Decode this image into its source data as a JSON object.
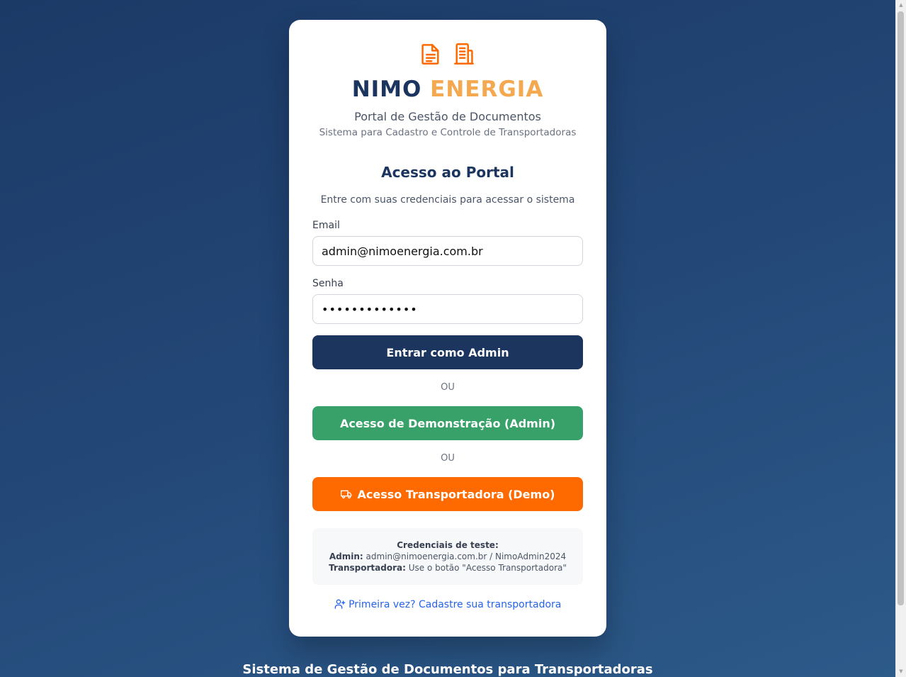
{
  "brand": {
    "name_part1": "NIMO",
    "name_part2": "ENERGIA",
    "subtitle": "Portal de Gestão de Documentos",
    "tagline": "Sistema para Cadastro e Controle de Transportadoras",
    "icons": [
      "document-icon",
      "building-icon"
    ]
  },
  "login": {
    "heading": "Acesso ao Portal",
    "lead": "Entre com suas credenciais para acessar o sistema",
    "email_label": "Email",
    "email_value": "admin@nimoenergia.com.br",
    "password_label": "Senha",
    "password_value": "NimoAdmin2024",
    "submit_label": "Entrar como Admin",
    "or_label_1": "OU",
    "demo_label": "Acesso de Demonstração (Admin)",
    "or_label_2": "OU",
    "carrier_label": "Acesso Transportadora (Demo)",
    "carrier_icon": "truck-icon"
  },
  "credentials": {
    "title": "Credenciais de teste:",
    "admin_key": "Admin:",
    "admin_value": "admin@nimoenergia.com.br / NimoAdmin2024",
    "carrier_key": "Transportadora:",
    "carrier_value": "Use o botão \"Acesso Transportadora\""
  },
  "register": {
    "icon": "user-plus-icon",
    "label": "Primeira vez? Cadastre sua transportadora"
  },
  "footer": {
    "text": "Sistema de Gestão de Documentos para Transportadoras"
  },
  "colors": {
    "navy": "#1b355e",
    "orange_brand": "#f4a850",
    "green": "#38a169",
    "orange_button": "#ff6a00",
    "link": "#2563eb"
  }
}
